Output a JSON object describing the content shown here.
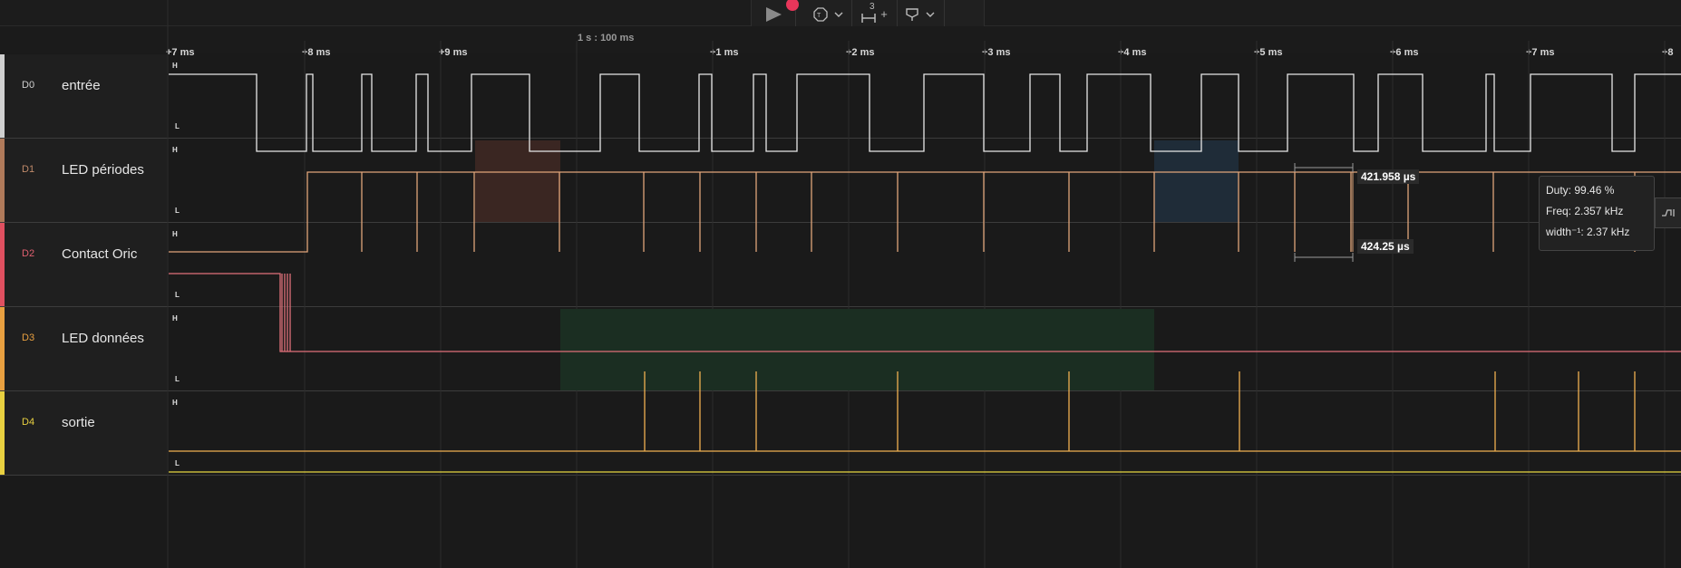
{
  "toolbar": {
    "play_icon": "play-icon",
    "record_icon": "record-dot-icon",
    "trigger_icon": "trigger-icon",
    "timing_label": "3",
    "timing_plus": "+",
    "marker_icon": "marker-icon"
  },
  "ruler": {
    "scale": "1 s : 100 ms",
    "ticks": [
      "+7 ms",
      "+8 ms",
      "+9 ms",
      "+1 ms",
      "+2 ms",
      "+3 ms",
      "+4 ms",
      "+5 ms",
      "+6 ms",
      "+7 ms",
      "+8"
    ]
  },
  "channels": [
    {
      "id": "D0",
      "name": "entrée",
      "color": "#d0d0d0",
      "wave_color": "#e8e8e8"
    },
    {
      "id": "D1",
      "name": "LED périodes",
      "color": "#b07a5a",
      "wave_color": "#e0a57a"
    },
    {
      "id": "D2",
      "name": "Contact Oric",
      "color": "#e05060",
      "wave_color": "#e0707a"
    },
    {
      "id": "D3",
      "name": "LED données",
      "color": "#e8a040",
      "wave_color": "#f0b050"
    },
    {
      "id": "D4",
      "name": "sortie",
      "color": "#e8d040",
      "wave_color": "#e8d840"
    }
  ],
  "levels": {
    "high": "H",
    "low": "L"
  },
  "measurements": {
    "top": "421.958 µs",
    "bottom": "424.25 µs"
  },
  "tooltip": {
    "duty": "Duty: 99.46 %",
    "freq": "Freq: 2.357 kHz",
    "width_inv": "width⁻¹: 2.37 kHz"
  },
  "side_button_icon": "edge-icon"
}
